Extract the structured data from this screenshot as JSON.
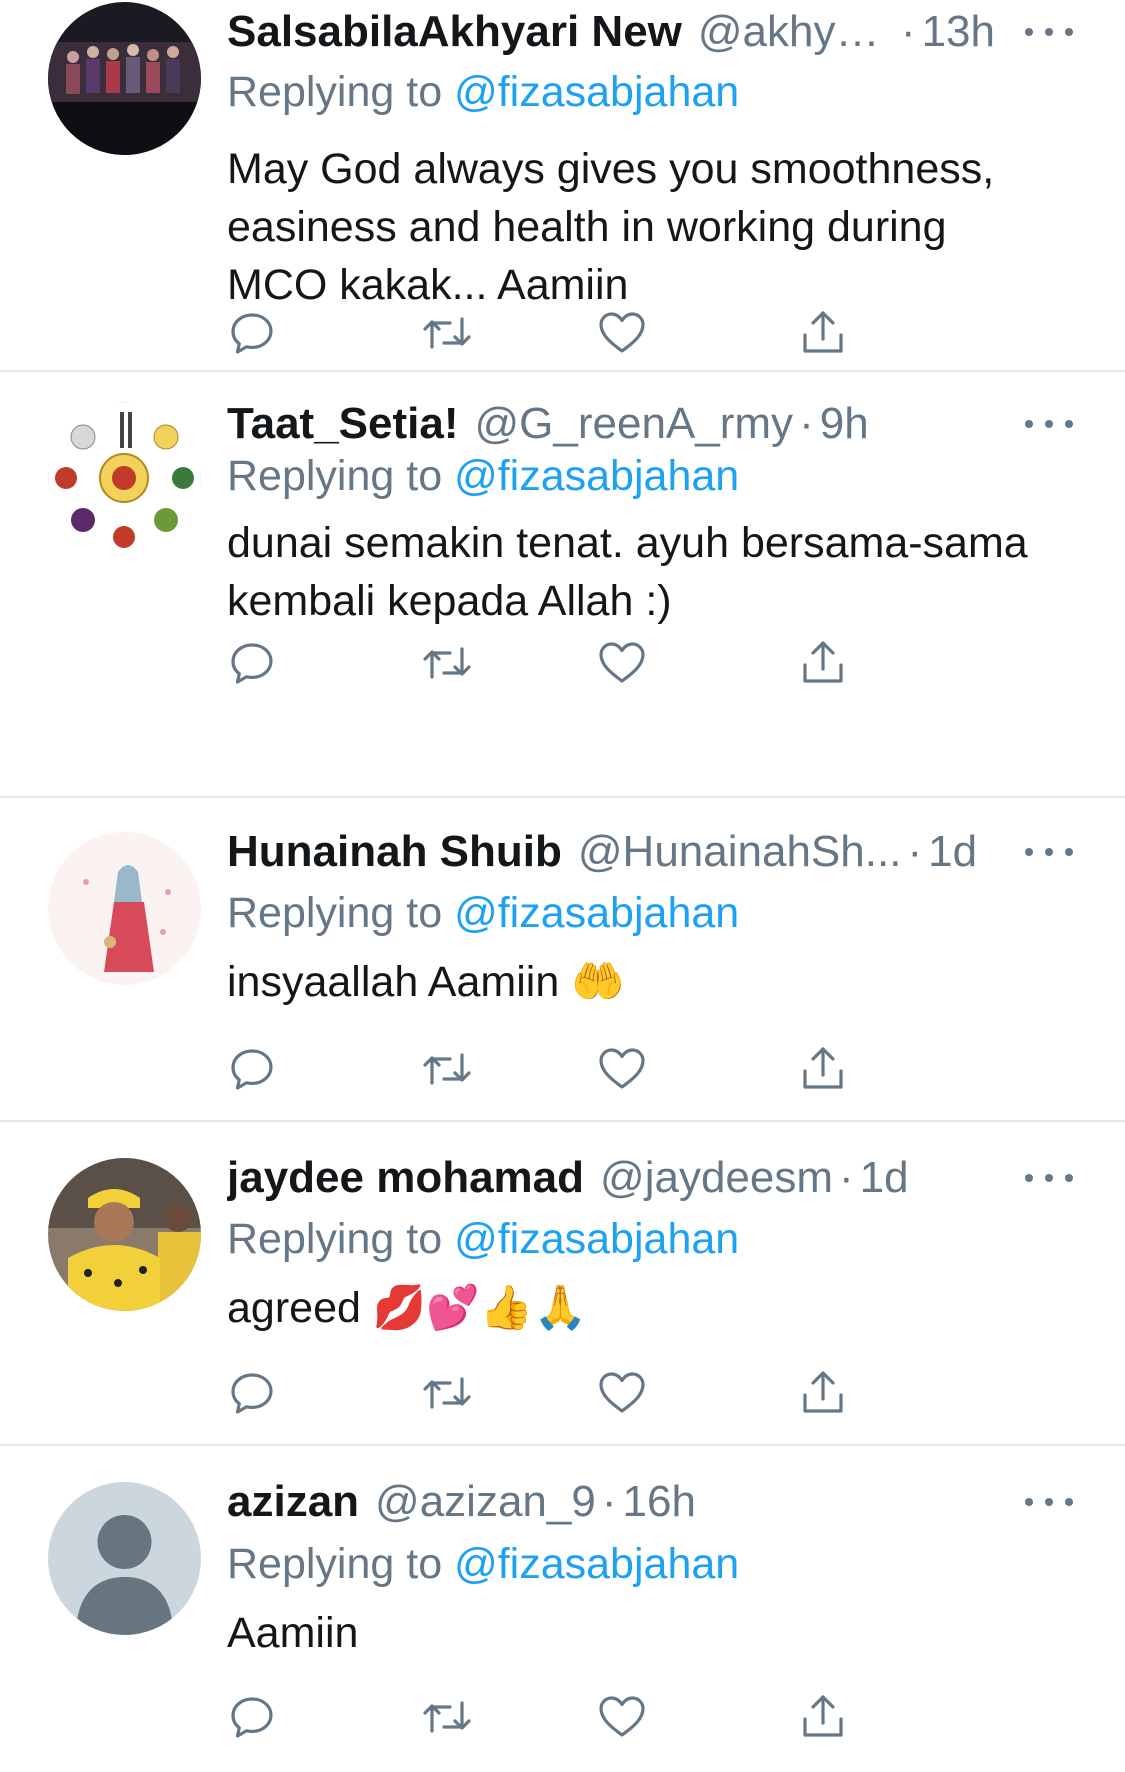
{
  "colors": {
    "text": "#14171a",
    "secondary": "#657786",
    "link": "#1da1f2",
    "divider": "#e1e8ed"
  },
  "icons": {
    "reply": "reply-icon",
    "retweet": "retweet-icon",
    "like": "heart-icon",
    "share": "share-icon",
    "more": "more-icon"
  },
  "tweets": [
    {
      "name": "SalsabilaAkhyari New",
      "handle": "@akhya...",
      "time": "13h",
      "replying_prefix": "Replying to ",
      "replying_to": "@fizasabjahan",
      "text": "May God always gives you smoothness, easiness and health in working during MCO kakak... Aamiin"
    },
    {
      "name": "Taat_Setia!",
      "handle": "@G_reenA_rmy",
      "time": "9h",
      "replying_prefix": "Replying to ",
      "replying_to": "@fizasabjahan",
      "text": "dunai semakin tenat. ayuh bersama-sama kembali kepada Allah :)"
    },
    {
      "name": "Hunainah Shuib",
      "handle": "@HunainahSh...",
      "time": "1d",
      "replying_prefix": "Replying to ",
      "replying_to": "@fizasabjahan",
      "text": "insyaallah Aamiin 🤲"
    },
    {
      "name": "jaydee mohamad",
      "handle": "@jaydeesm",
      "time": "1d",
      "replying_prefix": "Replying to ",
      "replying_to": "@fizasabjahan",
      "text": "agreed 💋💕👍🙏"
    },
    {
      "name": "azizan",
      "handle": "@azizan_9",
      "time": "16h",
      "replying_prefix": "Replying to ",
      "replying_to": "@fizasabjahan",
      "text": "Aamiin"
    }
  ],
  "separator": "·"
}
